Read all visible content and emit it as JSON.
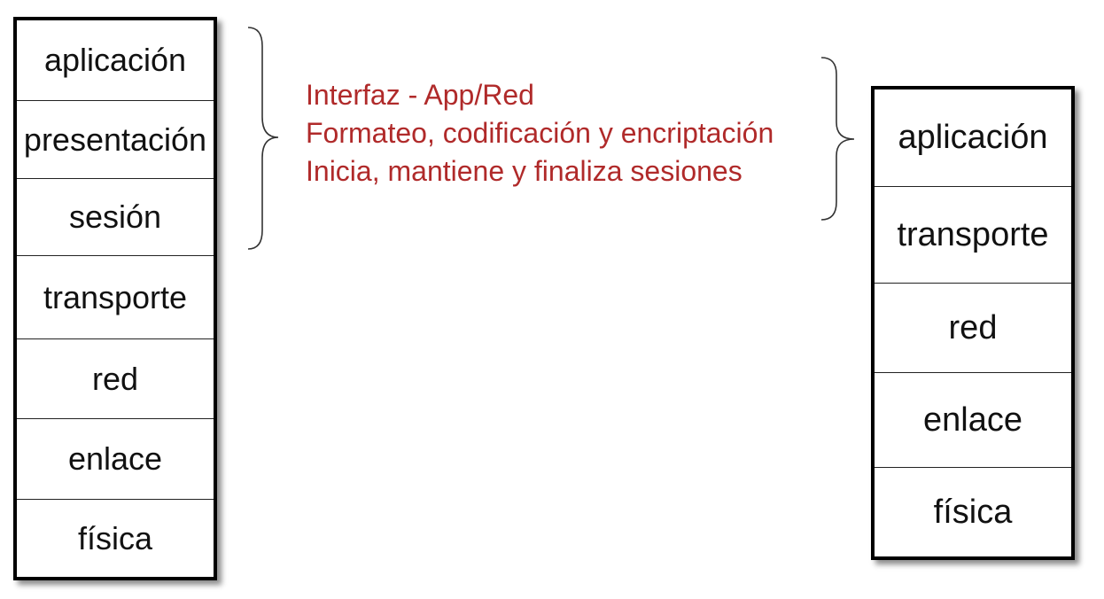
{
  "osi_stack": {
    "layers": [
      "aplicación",
      "presentación",
      "sesión",
      "transporte",
      "red",
      "enlace",
      "física"
    ]
  },
  "tcpip_stack": {
    "layers": [
      "aplicación",
      "transporte",
      "red",
      "enlace",
      "física"
    ]
  },
  "descriptions": [
    "Interfaz - App/Red",
    "Formateo, codificación y encriptación",
    "Inicia, mantiene y finaliza sesiones"
  ],
  "colors": {
    "description_text": "#b02a2a",
    "stack_border": "#000000"
  }
}
